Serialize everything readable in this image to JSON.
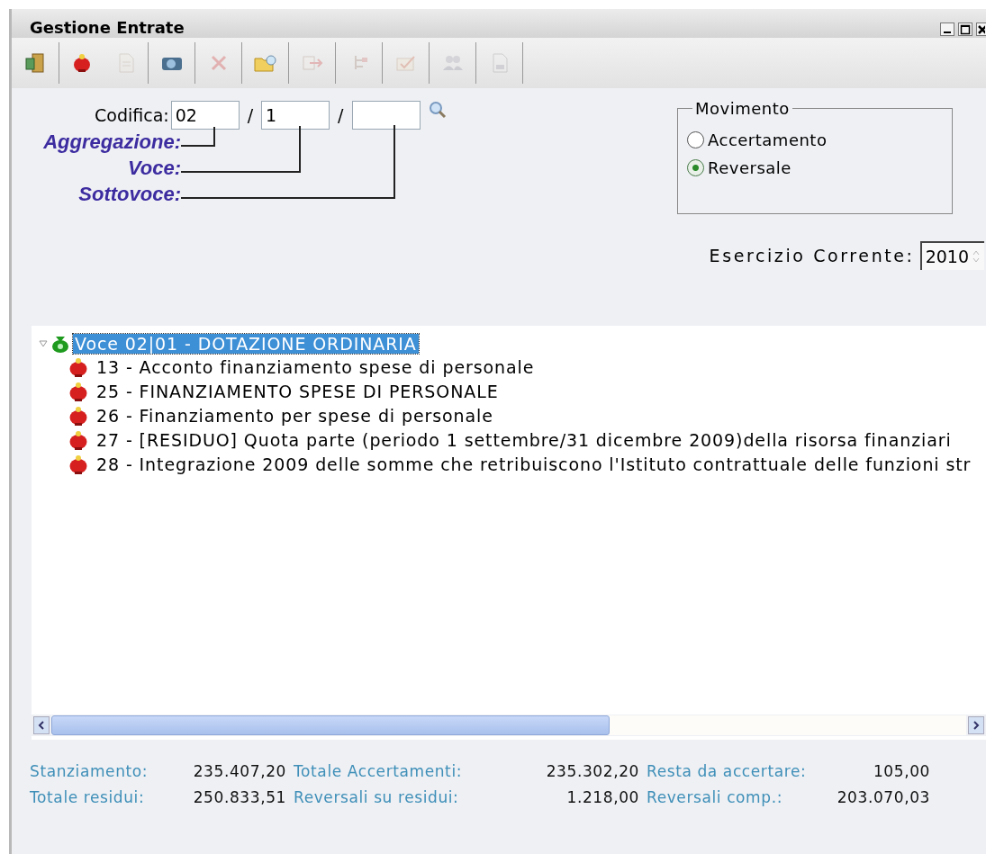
{
  "window": {
    "title": "Gestione Entrate"
  },
  "toolbar": [
    {
      "disabled": false
    },
    {
      "disabled": false
    },
    {
      "disabled": true
    },
    {
      "disabled": false
    },
    {
      "disabled": true
    },
    {
      "disabled": false
    },
    {
      "disabled": true
    },
    {
      "disabled": true
    },
    {
      "disabled": true
    },
    {
      "disabled": true
    },
    {
      "disabled": true
    }
  ],
  "codifica": {
    "label": "Codifica:",
    "fields": [
      "02",
      "1"
    ],
    "separators": [
      "/",
      "/"
    ],
    "legend": [
      "Aggregazione:",
      "Voce:",
      "Sottovoce:"
    ]
  },
  "movimento": {
    "title": "Movimento",
    "options": [
      {
        "label": "Accertamento",
        "selected": false
      },
      {
        "label": "Reversale",
        "selected": true
      }
    ]
  },
  "esercizio": {
    "label": "Esercizio Corrente:",
    "value": "2010"
  },
  "tree": {
    "label": "Voce 02|01 - DOTAZIONE ORDINARIA",
    "expanded": true,
    "selected": true,
    "children": [
      {
        "label": "13 - Acconto finanziamento spese di personale",
        "selected": false
      },
      {
        "label": "25 - FINANZIAMENTO SPESE DI PERSONALE",
        "selected": false
      },
      {
        "label": "26 - Finanziamento per spese di personale",
        "selected": false
      },
      {
        "label": "27 - [RESIDUO] Quota parte (periodo 1 settembre/31 dicembre 2009)della risorsa finanziari",
        "selected": false
      },
      {
        "label": "28 - Integrazione 2009 delle somme che retribuiscono l'Istituto contrattuale delle funzioni str",
        "selected": false
      }
    ]
  },
  "totals": [
    [
      {
        "label": "Stanziamento:",
        "value": "235.407,20"
      },
      {
        "label": "Totale Accertamenti:",
        "value": "235.302,20"
      },
      {
        "label": "Resta da accertare:",
        "value": "105,00"
      }
    ],
    [
      {
        "label": "Totale residui:",
        "value": "250.833,51"
      },
      {
        "label": "Reversali su residui:",
        "value": "1.218,00"
      },
      {
        "label": "Reversali comp.:",
        "value": "203.070,03"
      }
    ]
  ]
}
